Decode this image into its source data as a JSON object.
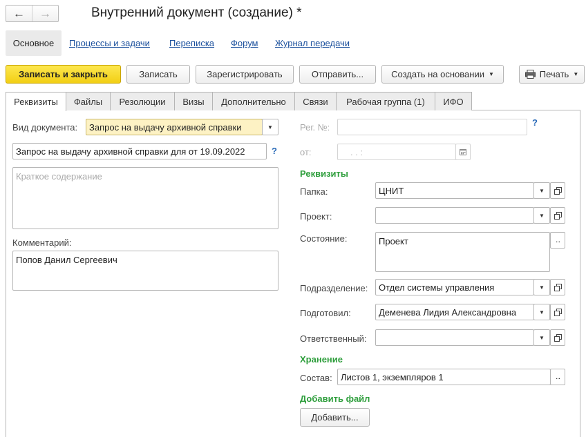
{
  "window": {
    "title": "Внутренний документ (создание) *"
  },
  "nav": {
    "back": "←",
    "forward": "→"
  },
  "sections": {
    "main": "Основное",
    "links": [
      "Процессы и задачи",
      "Переписка",
      "Форум",
      "Журнал передачи"
    ]
  },
  "toolbar": {
    "save_close": "Записать и закрыть",
    "save": "Записать",
    "register": "Зарегистрировать",
    "send": "Отправить...",
    "create_based": "Создать на основании",
    "print": "Печать"
  },
  "tabs": [
    "Реквизиты",
    "Файлы",
    "Резолюции",
    "Визы",
    "Дополнительно",
    "Связи",
    "Рабочая группа (1)",
    "ИФО"
  ],
  "form": {
    "doc_type_label": "Вид документа:",
    "doc_type_value": "Запрос на выдачу архивной справки",
    "title_value": "Запрос на выдачу архивной справки для  от 19.09.2022",
    "summary_placeholder": "Краткое содержание",
    "comment_label": "Комментарий:",
    "comment_value": "Попов Данил Сергеевич",
    "reg_label": "Рег. №:",
    "date_label": "от:",
    "date_mask": ".   .        :",
    "help": "?",
    "requisites_group": "Реквизиты",
    "folder_label": "Папка:",
    "folder_value": "ЦНИТ",
    "project_label": "Проект:",
    "project_value": "",
    "state_label": "Состояние:",
    "state_value": "Проект",
    "dept_label": "Подразделение:",
    "dept_value": "Отдел системы управления",
    "prepared_label": "Подготовил:",
    "prepared_value": "Деменева Лидия Александровна",
    "responsible_label": "Ответственный:",
    "responsible_value": "",
    "storage_group": "Хранение",
    "composition_label": "Состав:",
    "composition_value": "Листов 1, экземпляров 1",
    "add_file_group": "Добавить файл",
    "add_button": "Добавить..."
  }
}
